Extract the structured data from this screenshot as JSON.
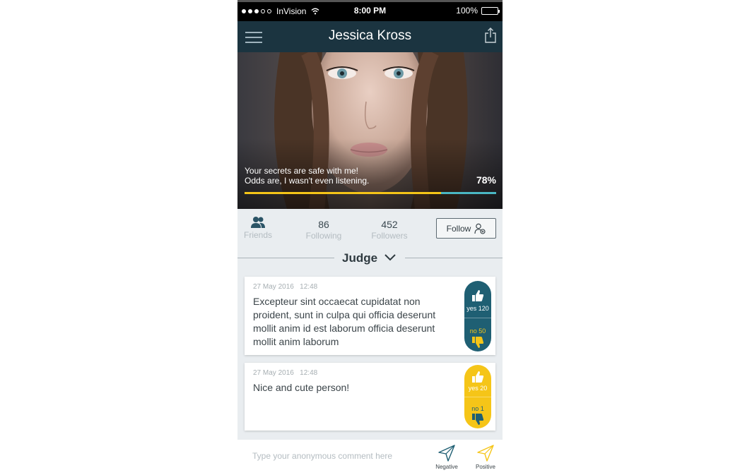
{
  "status_bar": {
    "carrier": "InVision",
    "time": "8:00 PM",
    "battery": "100%"
  },
  "header": {
    "title": "Jessica Kross"
  },
  "profile": {
    "bio_line1": "Your secrets are safe with me!",
    "bio_line2": "Odds are, I wasn't even listening.",
    "score_percent": "78%",
    "score_value": 0.78
  },
  "stats": {
    "friends_label": "Friends",
    "following_count": "86",
    "following_label": "Following",
    "followers_count": "452",
    "followers_label": "Followers",
    "follow_button": "Follow"
  },
  "section": {
    "label": "Judge"
  },
  "comments": [
    {
      "date": "27 May 2016",
      "time": "12:48",
      "text": "Excepteur sint occaecat cupidatat non proident, sunt in culpa qui officia deserunt mollit anim id est laborum officia deserunt mollit anim laborum",
      "yes": "yes 120",
      "no": "no  50",
      "color": "#1f5f73"
    },
    {
      "date": "27 May 2016",
      "time": "12:48",
      "text": "Nice and cute person!",
      "yes": "yes 20",
      "no": "no 1",
      "color": "#f5c518"
    }
  ],
  "composer": {
    "placeholder": "Type your anonymous comment here",
    "negative_label": "Negative",
    "positive_label": "Positive"
  },
  "colors": {
    "navy": "#1b3440",
    "teal": "#1f5f73",
    "yellow": "#f5c518",
    "cyan": "#4ab7c3"
  }
}
